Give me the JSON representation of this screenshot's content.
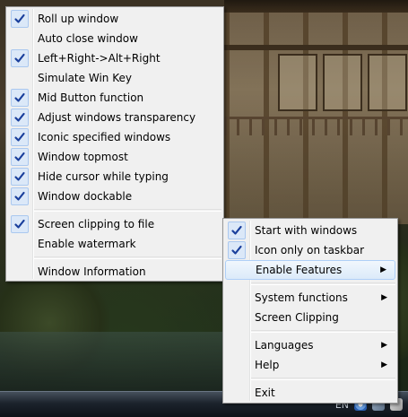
{
  "tray": {
    "language_indicator": "EN",
    "icons": [
      "network-icon",
      "volume-icon",
      "app-tray-icon"
    ]
  },
  "left_menu": {
    "items": [
      {
        "label": "Roll up window",
        "checked": true
      },
      {
        "label": "Auto close window",
        "checked": false
      },
      {
        "label": "Left+Right->Alt+Right",
        "checked": true
      },
      {
        "label": "Simulate Win Key",
        "checked": false
      },
      {
        "label": "Mid Button function",
        "checked": true
      },
      {
        "label": "Adjust windows transparency",
        "checked": true
      },
      {
        "label": "Iconic specified windows",
        "checked": true
      },
      {
        "label": "Window topmost",
        "checked": true
      },
      {
        "label": "Hide cursor while typing",
        "checked": true
      },
      {
        "label": "Window dockable",
        "checked": true
      },
      {
        "label": "Screen clipping to file",
        "checked": true
      },
      {
        "label": "Enable watermark",
        "checked": false
      },
      {
        "label": "Window Information",
        "checked": false
      }
    ]
  },
  "right_menu": {
    "items": [
      {
        "label": "Start with windows",
        "checked": true
      },
      {
        "label": "Icon only on taskbar",
        "checked": true
      },
      {
        "label": "Enable Features",
        "submenu": true,
        "highlighted": true
      },
      {
        "label": "System functions",
        "submenu": true
      },
      {
        "label": "Screen Clipping"
      },
      {
        "label": "Languages",
        "submenu": true
      },
      {
        "label": "Help",
        "submenu": true
      },
      {
        "label": "Exit"
      }
    ]
  },
  "colors": {
    "menu_bg": "#f0f0f0",
    "check_mark": "#1a3f9c",
    "check_bg": "#dbe8f8",
    "highlight": "#dbeaf9"
  }
}
